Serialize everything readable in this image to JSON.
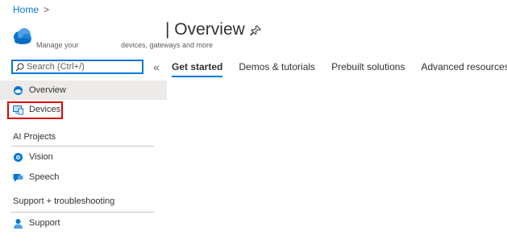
{
  "breadcrumb": {
    "home_label": "Home",
    "separator": ">"
  },
  "header": {
    "title": "| Overview",
    "subtitle_left": "Manage your",
    "subtitle_right": "devices, gateways and more",
    "icon": "cloud-icon",
    "pin_icon": "pin-icon"
  },
  "search": {
    "placeholder": "Search (Ctrl+/)",
    "value": ""
  },
  "collapse": {
    "label": "«"
  },
  "tabs": [
    {
      "label": "Get started",
      "active": true
    },
    {
      "label": "Demos & tutorials",
      "active": false
    },
    {
      "label": "Prebuilt solutions",
      "active": false
    },
    {
      "label": "Advanced resources",
      "active": false
    }
  ],
  "sidebar": {
    "items": [
      {
        "label": "Overview",
        "icon": "cloud-icon",
        "selected": true
      },
      {
        "label": "Devices",
        "icon": "devices-icon",
        "selected": false
      }
    ],
    "sections": [
      {
        "title": "AI Projects",
        "items": [
          {
            "label": "Vision",
            "icon": "vision-icon"
          },
          {
            "label": "Speech",
            "icon": "speech-icon"
          }
        ]
      },
      {
        "title": "Support + troubleshooting",
        "items": [
          {
            "label": "Support",
            "icon": "support-icon"
          }
        ]
      }
    ]
  },
  "colors": {
    "accent": "#0078d4",
    "highlight": "#e00000",
    "selected_bg": "#edebe9"
  }
}
